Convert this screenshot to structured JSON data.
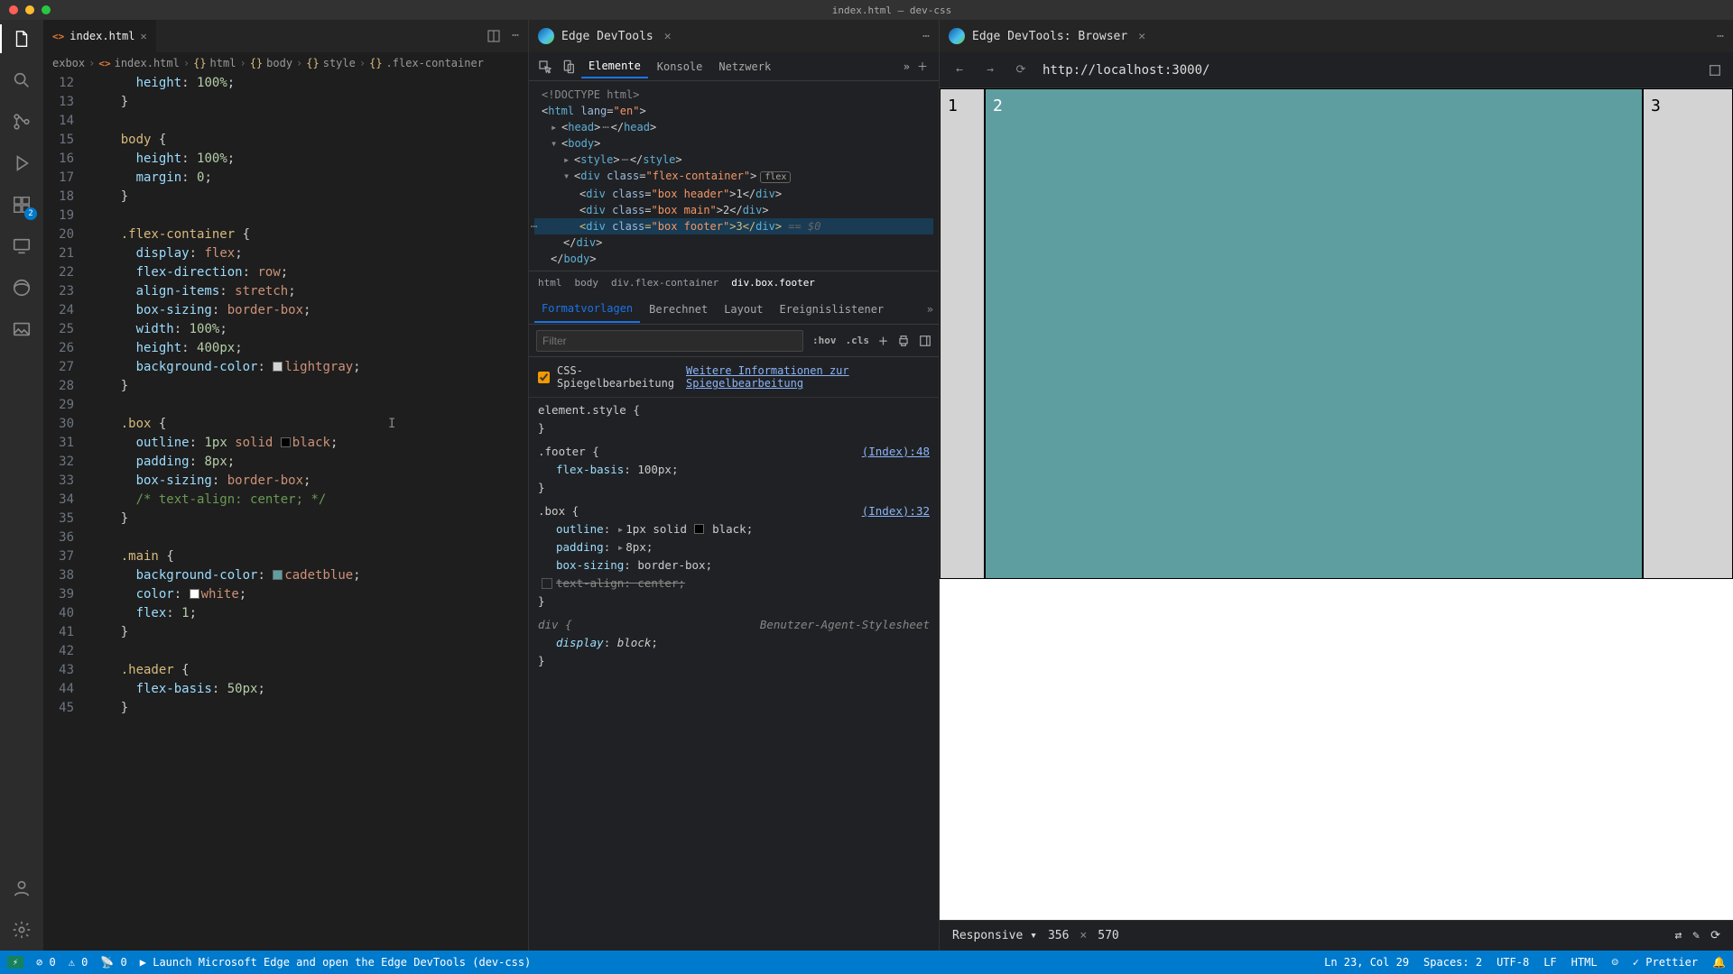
{
  "window": {
    "title": "index.html — dev-css"
  },
  "activity": {
    "badge": "2"
  },
  "editor": {
    "tab": {
      "icon": "<>",
      "name": "index.html"
    },
    "breadcrumb": [
      "exbox",
      "index.html",
      "html",
      "body",
      "style",
      ".flex-container"
    ],
    "lines": [
      {
        "n": 12,
        "h": "      <span class='prop'>height</span><span class='pun'>:</span> <span class='num'>100%</span><span class='pun'>;</span>"
      },
      {
        "n": 13,
        "h": "    <span class='pun'>}</span>"
      },
      {
        "n": 14,
        "h": ""
      },
      {
        "n": 15,
        "h": "    <span class='sel'>body</span> <span class='pun'>{</span>"
      },
      {
        "n": 16,
        "h": "      <span class='prop'>height</span><span class='pun'>:</span> <span class='num'>100%</span><span class='pun'>;</span>"
      },
      {
        "n": 17,
        "h": "      <span class='prop'>margin</span><span class='pun'>:</span> <span class='num'>0</span><span class='pun'>;</span>"
      },
      {
        "n": 18,
        "h": "    <span class='pun'>}</span>"
      },
      {
        "n": 19,
        "h": ""
      },
      {
        "n": 20,
        "h": "    <span class='sel'>.flex-container</span> <span class='pun'>{</span>"
      },
      {
        "n": 21,
        "h": "      <span class='prop'>display</span><span class='pun'>:</span> <span class='val'>flex</span><span class='pun'>;</span>"
      },
      {
        "n": 22,
        "h": "      <span class='prop'>flex-direction</span><span class='pun'>:</span> <span class='val'>row</span><span class='pun'>;</span>"
      },
      {
        "n": 23,
        "h": "      <span class='prop'>align-items</span><span class='pun'>:</span> <span class='val'>stretch</span><span class='pun'>;</span>"
      },
      {
        "n": 24,
        "h": "      <span class='prop'>box-sizing</span><span class='pun'>:</span> <span class='val'>border-box</span><span class='pun'>;</span>"
      },
      {
        "n": 25,
        "h": "      <span class='prop'>width</span><span class='pun'>:</span> <span class='num'>100%</span><span class='pun'>;</span>"
      },
      {
        "n": 26,
        "h": "      <span class='prop'>height</span><span class='pun'>:</span> <span class='num'>400px</span><span class='pun'>;</span>"
      },
      {
        "n": 27,
        "h": "      <span class='prop'>background-color</span><span class='pun'>:</span> <span class='colorchip' style='background:#d3d3d3'></span><span class='val'>lightgray</span><span class='pun'>;</span>"
      },
      {
        "n": 28,
        "h": "    <span class='pun'>}</span>"
      },
      {
        "n": 29,
        "h": ""
      },
      {
        "n": 30,
        "h": "    <span class='sel'>.box</span> <span class='pun'>{</span>"
      },
      {
        "n": 31,
        "h": "      <span class='prop'>outline</span><span class='pun'>:</span> <span class='num'>1px</span> <span class='val'>solid</span> <span class='colorchip' style='background:#000'></span><span class='val'>black</span><span class='pun'>;</span>"
      },
      {
        "n": 32,
        "h": "      <span class='prop'>padding</span><span class='pun'>:</span> <span class='num'>8px</span><span class='pun'>;</span>"
      },
      {
        "n": 33,
        "h": "      <span class='prop'>box-sizing</span><span class='pun'>:</span> <span class='val'>border-box</span><span class='pun'>;</span>"
      },
      {
        "n": 34,
        "h": "      <span class='cmt'>/* text-align: center; */</span>"
      },
      {
        "n": 35,
        "h": "    <span class='pun'>}</span>"
      },
      {
        "n": 36,
        "h": ""
      },
      {
        "n": 37,
        "h": "    <span class='sel'>.main</span> <span class='pun'>{</span>"
      },
      {
        "n": 38,
        "h": "      <span class='prop'>background-color</span><span class='pun'>:</span> <span class='colorchip' style='background:#5f9ea0'></span><span class='val'>cadetblue</span><span class='pun'>;</span>"
      },
      {
        "n": 39,
        "h": "      <span class='prop'>color</span><span class='pun'>:</span> <span class='colorchip' style='background:#fff'></span><span class='val'>white</span><span class='pun'>;</span>"
      },
      {
        "n": 40,
        "h": "      <span class='prop'>flex</span><span class='pun'>:</span> <span class='num'>1</span><span class='pun'>;</span>"
      },
      {
        "n": 41,
        "h": "    <span class='pun'>}</span>"
      },
      {
        "n": 42,
        "h": ""
      },
      {
        "n": 43,
        "h": "    <span class='sel'>.header</span> <span class='pun'>{</span>"
      },
      {
        "n": 44,
        "h": "      <span class='prop'>flex-basis</span><span class='pun'>:</span> <span class='num'>50px</span><span class='pun'>;</span>"
      },
      {
        "n": 45,
        "h": "    <span class='pun'>}</span>"
      }
    ]
  },
  "devtools": {
    "tab": "Edge DevTools",
    "toolbar": [
      "Elemente",
      "Konsole",
      "Netzwerk"
    ],
    "dom": {
      "doctype": "<!DOCTYPE html>",
      "htmlOpen": "html",
      "lang": "en",
      "head": "head",
      "body": "body",
      "style": "style",
      "div": "div",
      "classAttr": "class",
      "fc": "flex-container",
      "flexBadge": "flex",
      "bh": "box header",
      "bhv": "1",
      "bm": "box main",
      "bmv": "2",
      "bf": "box footer",
      "bfv": "3",
      "annot": "== $0"
    },
    "crumbs": [
      "html",
      "body",
      "div.flex-container",
      "div.box.footer"
    ],
    "stylesTabs": [
      "Formatvorlagen",
      "Berechnet",
      "Layout",
      "Ereignislistener"
    ],
    "filterPlaceholder": "Filter",
    "hov": ":hov",
    "cls": ".cls",
    "mirror": {
      "label": "CSS-Spiegelbearbeitung",
      "link": "Weitere Informationen zur Spiegelbearbeitung"
    },
    "rules": {
      "elstyle": "element.style {",
      "footer": {
        "sel": ".footer {",
        "link": "(Index):48",
        "p1": "flex-basis",
        "v1": "100px"
      },
      "box": {
        "sel": ".box {",
        "link": "(Index):32",
        "p1": "outline",
        "v1": "1px solid ",
        "v1b": "black",
        "p2": "padding",
        "v2": "8px",
        "p3": "box-sizing",
        "v3": "border-box",
        "p4": "text-align: center;"
      },
      "div": {
        "sel": "div {",
        "ua": "Benutzer-Agent-Stylesheet",
        "p1": "display",
        "v1": "block"
      },
      "close": "}"
    }
  },
  "browser": {
    "tab": "Edge DevTools: Browser",
    "url": "http://localhost:3000/",
    "b1": "1",
    "b2": "2",
    "b3": "3",
    "mode": "Responsive",
    "vw": "356",
    "vh": "570",
    "x": "×"
  },
  "status": {
    "errors": "0",
    "warnings": "0",
    "ports": "0",
    "launch": "Launch Microsoft Edge and open the Edge DevTools (dev-css)",
    "ln": "Ln 23, Col 29",
    "spaces": "Spaces: 2",
    "enc": "UTF-8",
    "eol": "LF",
    "lang": "HTML",
    "prettier": "Prettier"
  }
}
